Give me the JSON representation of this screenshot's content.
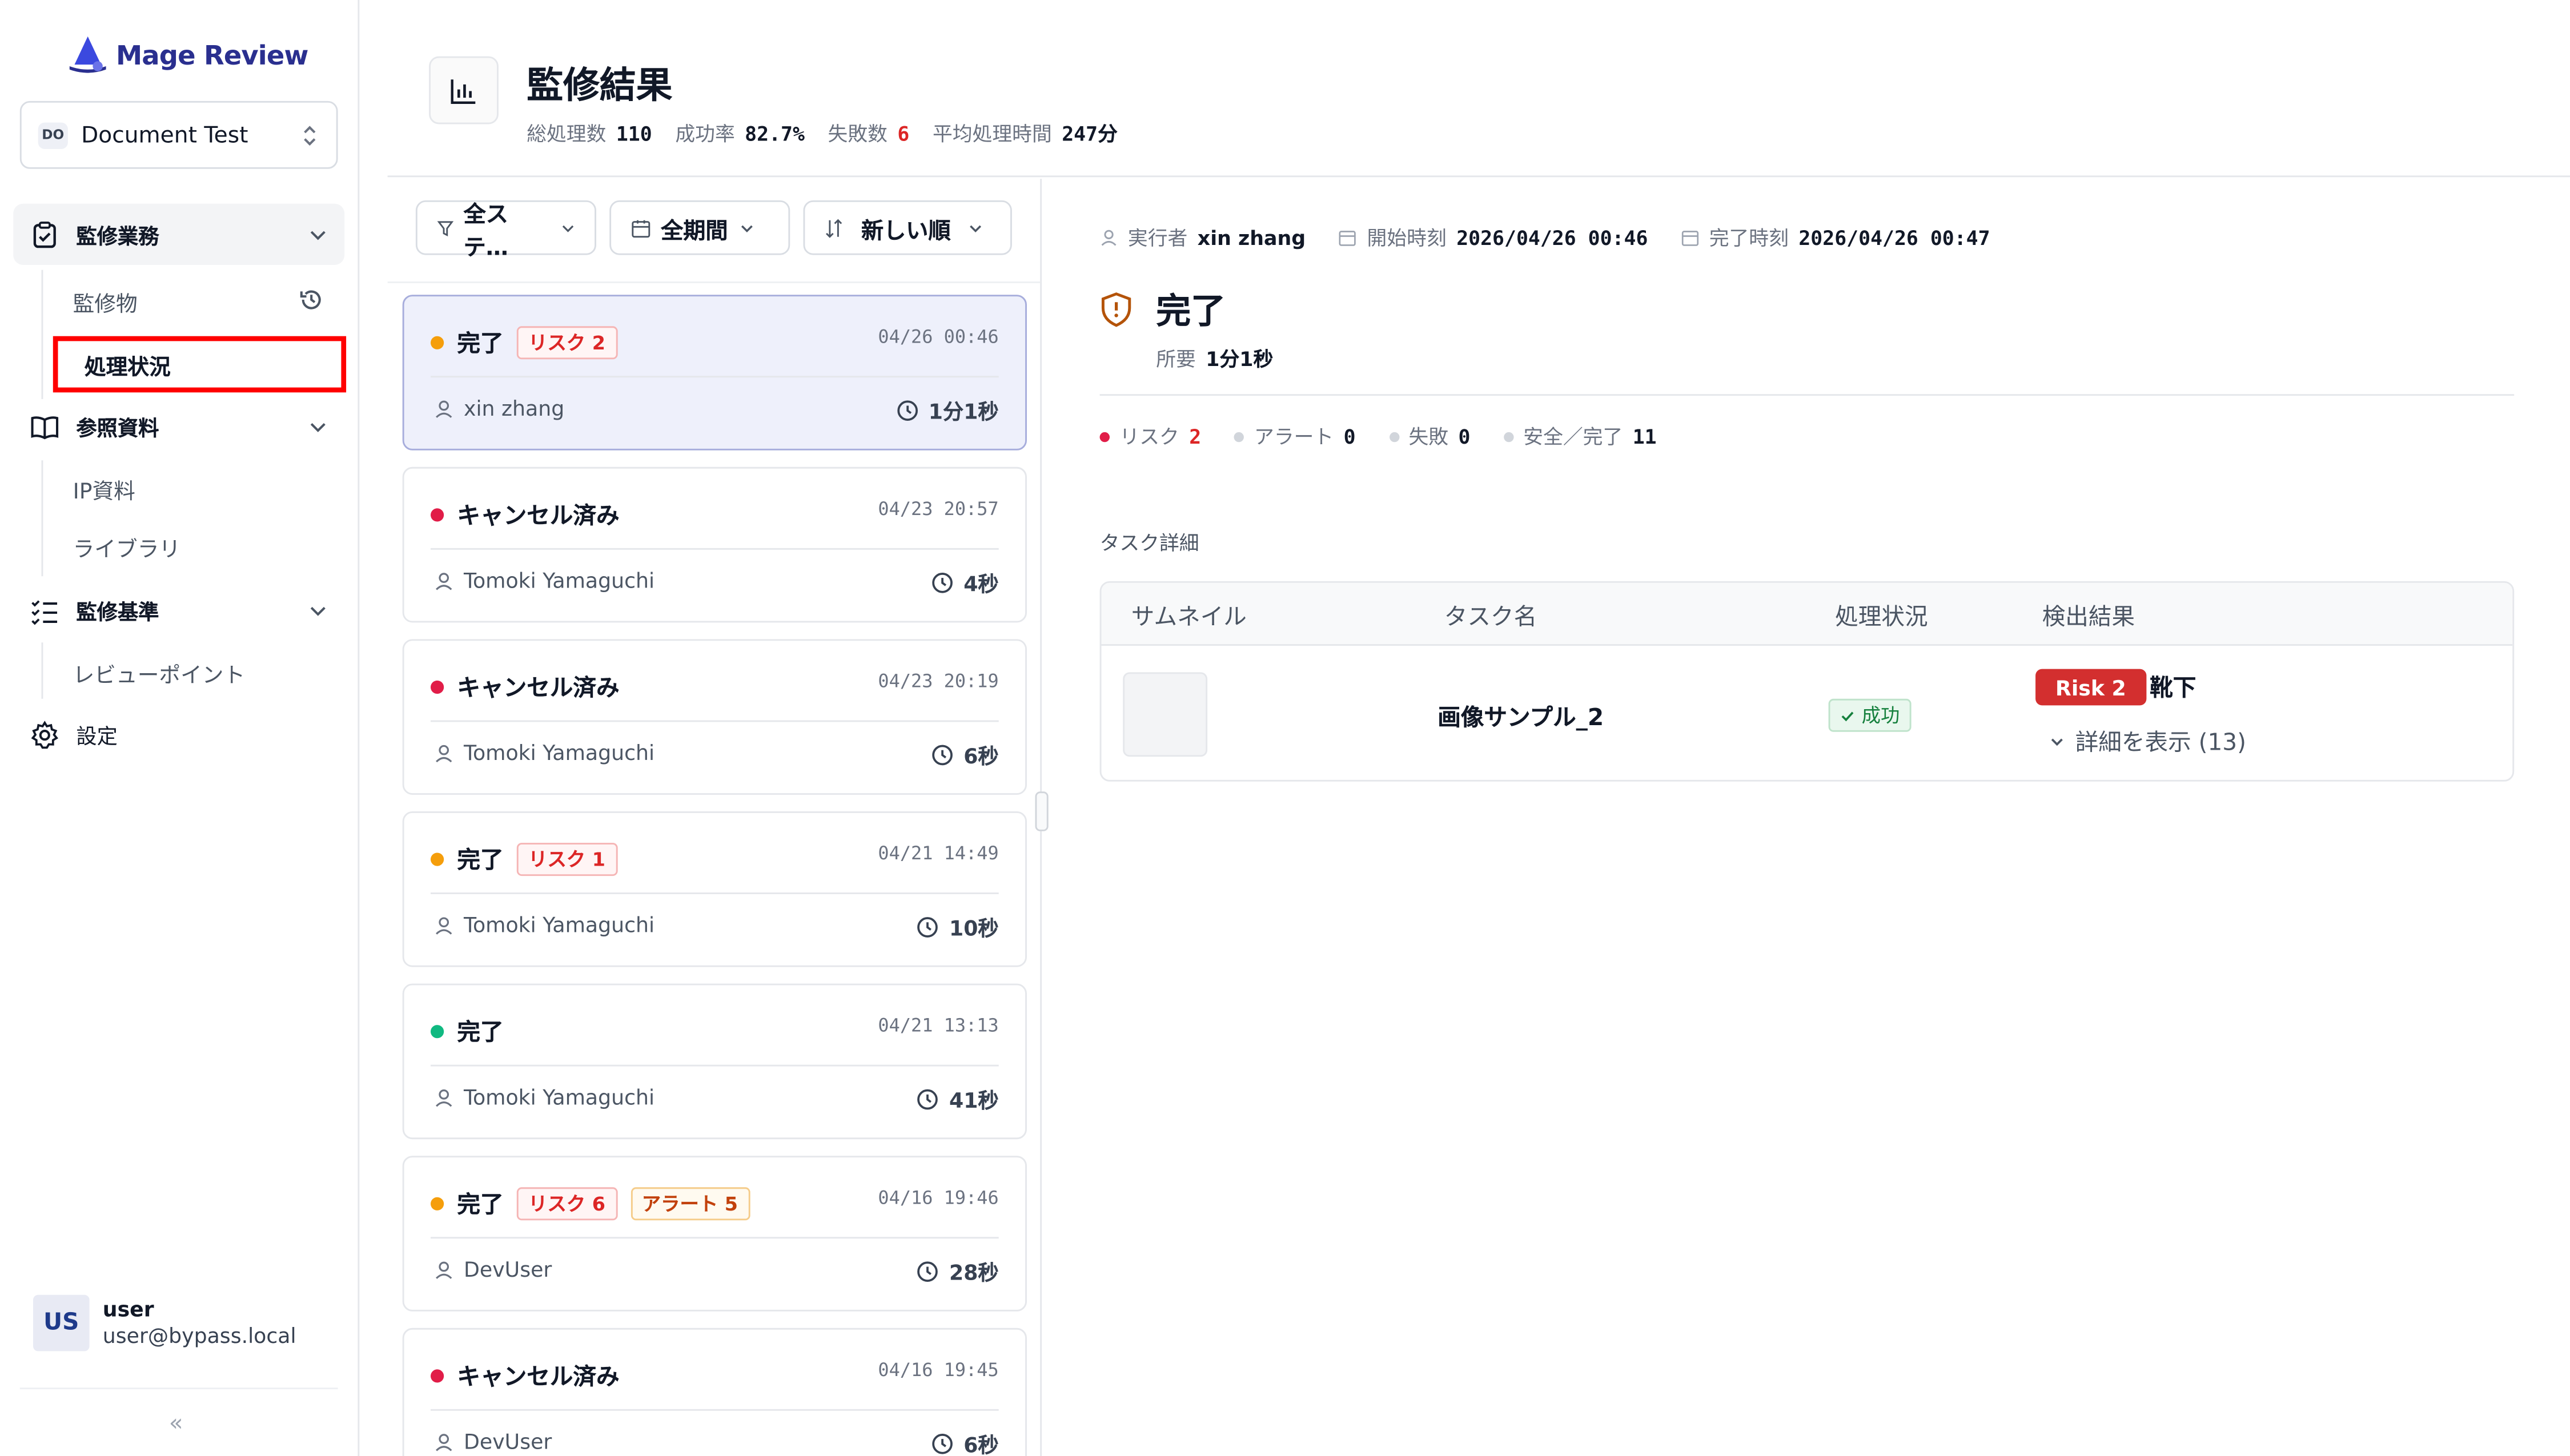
{
  "app": {
    "name": "Mage Review",
    "brand_color": "#2a2f8f"
  },
  "workspace": {
    "badge": "DO",
    "name": "Document Test"
  },
  "nav": {
    "group1": {
      "label": "監修業務",
      "items": [
        {
          "label": "監修物"
        },
        {
          "label": "処理状況"
        }
      ]
    },
    "group2": {
      "label": "参照資料",
      "items": [
        {
          "label": "IP資料"
        },
        {
          "label": "ライブラリ"
        }
      ]
    },
    "group3": {
      "label": "監修基準",
      "items": [
        {
          "label": "レビューポイント"
        }
      ]
    },
    "settings": {
      "label": "設定"
    }
  },
  "user": {
    "initials": "US",
    "name": "user",
    "email": "user@bypass.local",
    "collapse": "«"
  },
  "header": {
    "title": "監修結果",
    "stats": [
      {
        "label": "総処理数",
        "value": "110"
      },
      {
        "label": "成功率",
        "value": "82.7%"
      },
      {
        "label": "失敗数",
        "value": "6"
      },
      {
        "label": "平均処理時間",
        "value": "247分"
      }
    ]
  },
  "filters": {
    "status": "全ステ…",
    "period": "全期間",
    "sort": "新しい順"
  },
  "jobs": [
    {
      "status": "完了",
      "dot": "#f59e0b",
      "tags": [
        {
          "type": "risk",
          "text": "リスク 2"
        }
      ],
      "date": "04/26 00:46",
      "user": "xin zhang",
      "duration": "1分1秒",
      "selected": true
    },
    {
      "status": "キャンセル済み",
      "dot": "#e11d48",
      "tags": [],
      "date": "04/23 20:57",
      "user": "Tomoki Yamaguchi",
      "duration": "4秒"
    },
    {
      "status": "キャンセル済み",
      "dot": "#e11d48",
      "tags": [],
      "date": "04/23 20:19",
      "user": "Tomoki Yamaguchi",
      "duration": "6秒"
    },
    {
      "status": "完了",
      "dot": "#f59e0b",
      "tags": [
        {
          "type": "risk",
          "text": "リスク 1"
        }
      ],
      "date": "04/21 14:49",
      "user": "Tomoki Yamaguchi",
      "duration": "10秒"
    },
    {
      "status": "完了",
      "dot": "#10b981",
      "tags": [],
      "date": "04/21 13:13",
      "user": "Tomoki Yamaguchi",
      "duration": "41秒"
    },
    {
      "status": "完了",
      "dot": "#f59e0b",
      "tags": [
        {
          "type": "risk",
          "text": "リスク 6"
        },
        {
          "type": "alert",
          "text": "アラート 5"
        }
      ],
      "date": "04/16 19:46",
      "user": "DevUser",
      "duration": "28秒"
    },
    {
      "status": "キャンセル済み",
      "dot": "#e11d48",
      "tags": [],
      "date": "04/16 19:45",
      "user": "DevUser",
      "duration": "6秒"
    }
  ],
  "detail": {
    "executor_label": "実行者",
    "executor": "xin zhang",
    "start_label": "開始時刻",
    "start": "2026/04/26 00:46",
    "end_label": "完了時刻",
    "end": "2026/04/26 00:47",
    "status": "完了",
    "duration_label": "所要",
    "duration": "1分1秒",
    "counts": [
      {
        "label": "リスク",
        "value": "2",
        "dot": "#e11d48"
      },
      {
        "label": "アラート",
        "value": "0",
        "dot": "#d1d5db"
      },
      {
        "label": "失敗",
        "value": "0",
        "dot": "#d1d5db"
      },
      {
        "label": "安全／完了",
        "value": "11",
        "dot": "#d1d5db"
      }
    ],
    "section_label": "タスク詳細",
    "table": {
      "headers": [
        "サムネイル",
        "タスク名",
        "処理状況",
        "検出結果"
      ],
      "row": {
        "task_name": "画像サンプル_2",
        "status": "成功",
        "risk_badge": "Risk 2",
        "risk_label": "靴下",
        "expand": "詳細を表示 (13)"
      }
    }
  }
}
